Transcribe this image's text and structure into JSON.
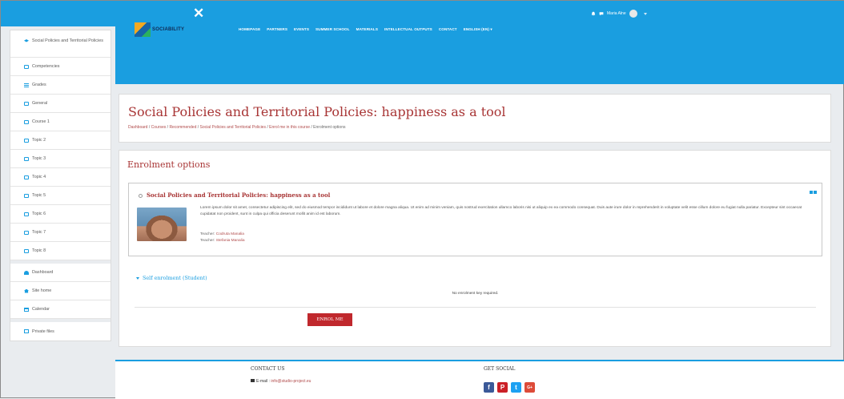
{
  "topbar": {
    "close_glyph": "✕",
    "user_name": "Maria Alne"
  },
  "sidebar": {
    "course_items": [
      {
        "label": "Social Policies and Territorial Policies",
        "icon": "graduation-cap-icon"
      },
      {
        "label": "Competencies",
        "icon": "competencies-icon"
      },
      {
        "label": "Grades",
        "icon": "grades-icon"
      },
      {
        "label": "General",
        "icon": "folder-icon"
      },
      {
        "label": "Course 1",
        "icon": "folder-icon"
      },
      {
        "label": "Topic 2",
        "icon": "folder-icon"
      },
      {
        "label": "Topic 3",
        "icon": "folder-icon"
      },
      {
        "label": "Topic 4",
        "icon": "folder-icon"
      },
      {
        "label": "Topic 5",
        "icon": "folder-icon"
      },
      {
        "label": "Topic 6",
        "icon": "folder-icon"
      },
      {
        "label": "Topic 7",
        "icon": "folder-icon"
      },
      {
        "label": "Topic 8",
        "icon": "folder-icon"
      }
    ],
    "site_items": [
      {
        "label": "Dashboard",
        "icon": "dashboard-icon"
      },
      {
        "label": "Site home",
        "icon": "home-icon"
      },
      {
        "label": "Calendar",
        "icon": "calendar-icon"
      }
    ],
    "extra_items": [
      {
        "label": "Private files",
        "icon": "file-icon"
      }
    ]
  },
  "header": {
    "logo_text": "SOCIABILITY",
    "nav": [
      "HOMEPAGE",
      "PARTNERS",
      "EVENTS",
      "SUMMER SCHOOL",
      "MATERIALS",
      "INTELLECTUAL OUTPUTS",
      "CONTACT",
      "ENGLISH (EN) ▾"
    ]
  },
  "page": {
    "title": "Social Policies and Territorial Policies: happiness as a tool",
    "breadcrumb": [
      "Dashboard",
      "Courses",
      "Recommended",
      "Social Policies and Territorial Policies",
      "Enrol me in this course",
      "Enrolment options"
    ]
  },
  "enrolment": {
    "section_title": "Enrolment options",
    "course_name": "Social Policies and Territorial Policies: happiness as a tool",
    "description": "Lorem ipsum dolor sit amet, consectetur adipiscing elit, sed do eiusmod tempor incididunt ut labore et dolore magna aliqua. Ut enim ad minim veniam, quis nostrud exercitation ullamco laboris nisi ut aliquip ex ea commodo consequat. Duis aute irure dolor in reprehenderit in voluptate velit esse cillum dolore eu fugiat nulla pariatur. Excepteur sint occaecat cupidatat non proident, sunt in culpa qui officia deserunt mollit anim id est laborum.",
    "teacher_label": "Teacher:",
    "teachers": [
      "Codruta Manalia",
      "Stefania Manalia"
    ],
    "self_enrol_title": "Self enrolment (Student)",
    "no_key_text": "No enrolment key required.",
    "enrol_button": "ENROL ME"
  },
  "footer": {
    "contact_heading": "CONTACT US",
    "email_label": "E-mail :",
    "email": "info@studio-project.eu",
    "social_heading": "GET SOCIAL",
    "social": [
      {
        "icon": "facebook-icon",
        "glyph": "f"
      },
      {
        "icon": "pinterest-icon",
        "glyph": "P"
      },
      {
        "icon": "twitter-icon",
        "glyph": "t"
      },
      {
        "icon": "google-plus-icon",
        "glyph": "G+"
      }
    ]
  }
}
